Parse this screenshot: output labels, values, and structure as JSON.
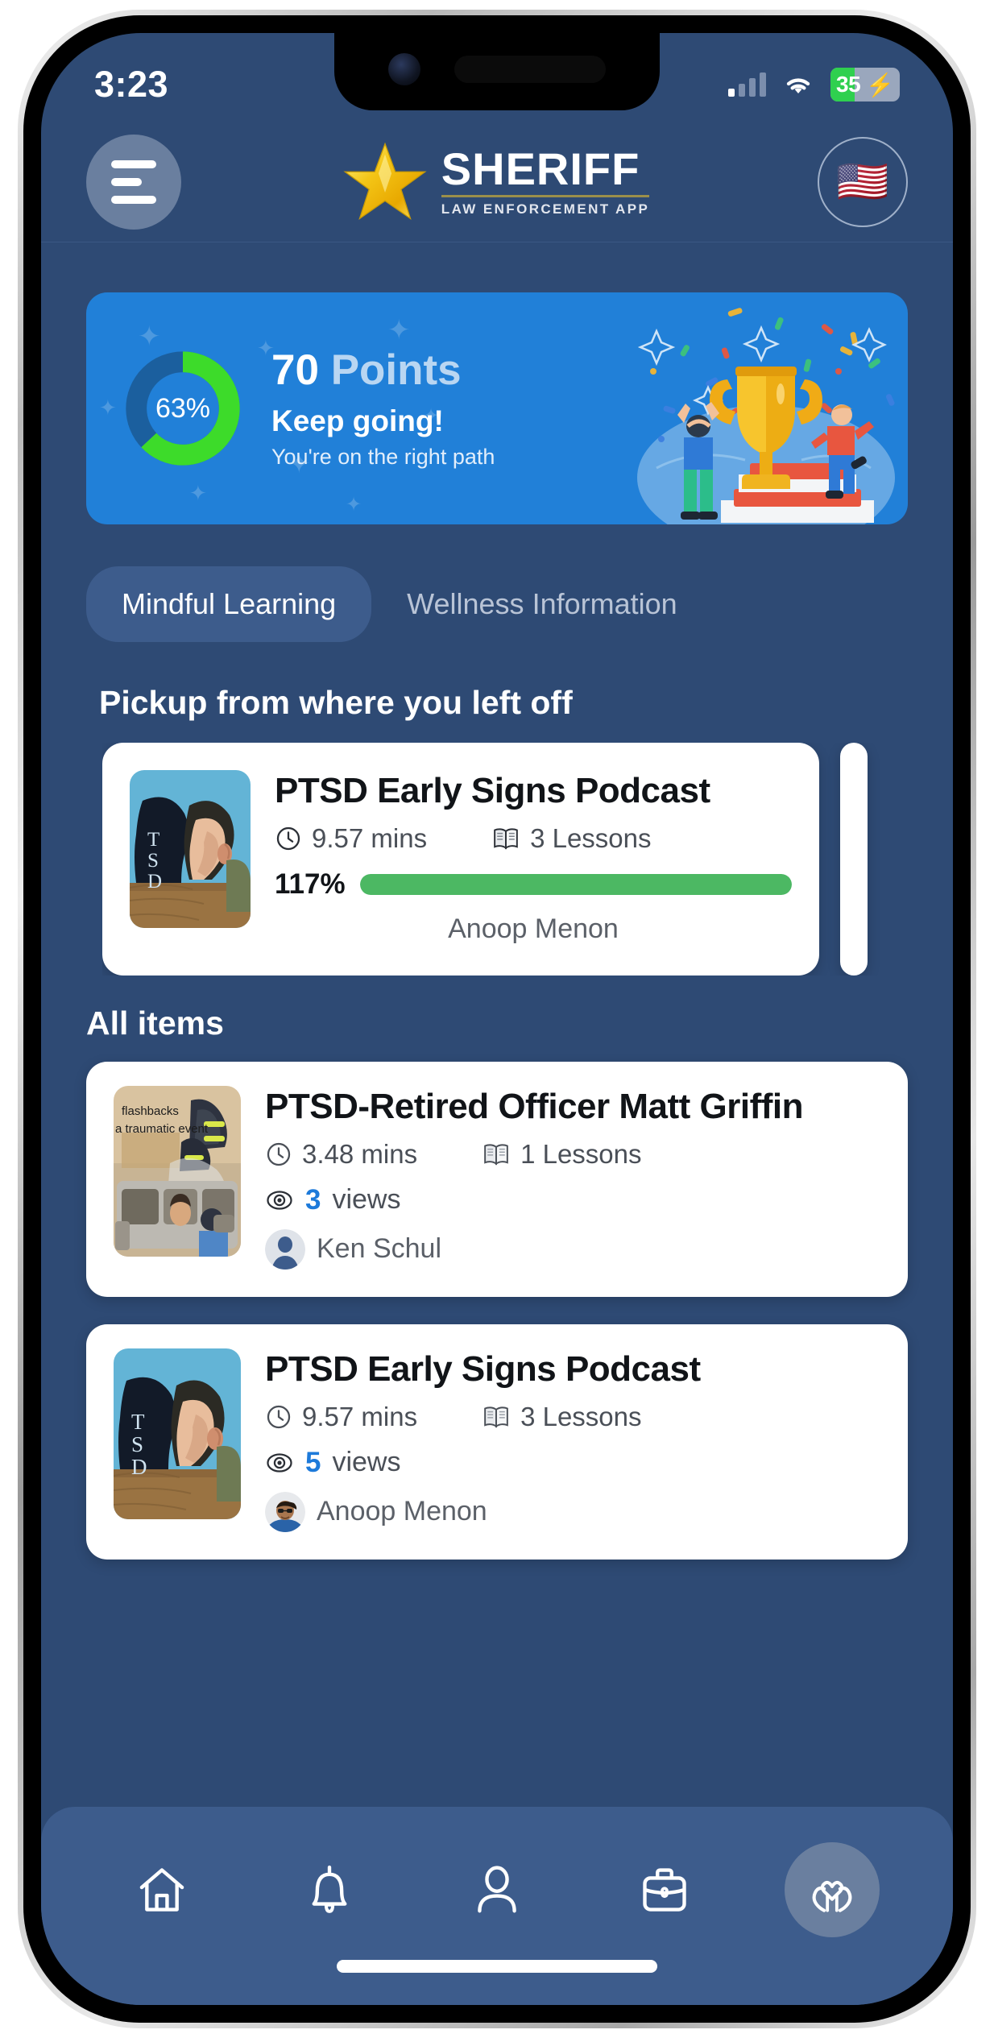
{
  "status_bar": {
    "time": "3:23",
    "signal_icon": "cellular-signal-icon",
    "wifi_icon": "wifi-icon",
    "battery_level": "35",
    "battery_charging": true,
    "battery_percent_value": 35
  },
  "header": {
    "menu_icon": "hamburger-menu-icon",
    "brand_title": "SHERIFF",
    "brand_subtitle": "LAW ENFORCEMENT APP",
    "brand_star_icon": "star-icon",
    "language_flag": "united-states-flag-icon",
    "flag_glyph": "🇺🇸"
  },
  "points_banner": {
    "progress_percent_label": "63%",
    "progress_percent_value": 63,
    "points_number": "70",
    "points_unit": "Points",
    "headline": "Keep going!",
    "subtext": "You're on the right path",
    "ring_color": "#3ddb2a",
    "ring_track_color": "#1b5f9e",
    "card_color": "#2180d8",
    "illustration": "trophy-celebration-illustration"
  },
  "tabs": [
    {
      "label": "Mindful Learning",
      "active": true
    },
    {
      "label": "Wellness Information",
      "active": false
    }
  ],
  "continue_section": {
    "heading": "Pickup from where you left off",
    "cards": [
      {
        "title": "PTSD Early Signs Podcast",
        "duration": "9.57 mins",
        "lessons": "3 Lessons",
        "progress_label": "117%",
        "progress_value": 100,
        "author": "Anoop Menon",
        "thumbnail": "ptsd-silhouette-thumbnail",
        "clock_icon": "clock-icon",
        "book_icon": "book-icon"
      }
    ]
  },
  "all_items_section": {
    "heading": "All items",
    "cards": [
      {
        "title": "PTSD-Retired Officer Matt Griffin",
        "duration": "3.48 mins",
        "lessons": "1 Lessons",
        "views_count": "3",
        "views_label": "views",
        "author": "Ken Schul",
        "thumbnail": "flashbacks-emergency-scene-thumbnail",
        "thumbnail_caption_line1": "flashbacks",
        "thumbnail_caption_line2": "a traumatic event",
        "avatar": "default-person-avatar",
        "clock_icon": "clock-icon",
        "book_icon": "book-icon",
        "eye_icon": "eye-icon"
      },
      {
        "title": "PTSD Early Signs Podcast",
        "duration": "9.57 mins",
        "lessons": "3 Lessons",
        "views_count": "5",
        "views_label": "views",
        "author": "Anoop Menon",
        "thumbnail": "ptsd-silhouette-thumbnail",
        "avatar": "anoop-menon-photo-avatar",
        "clock_icon": "clock-icon",
        "book_icon": "book-icon",
        "eye_icon": "eye-icon"
      }
    ]
  },
  "bottom_nav": [
    {
      "icon": "home-icon",
      "active": false
    },
    {
      "icon": "bell-icon",
      "active": false
    },
    {
      "icon": "person-icon",
      "active": false
    },
    {
      "icon": "briefcase-icon",
      "active": false
    },
    {
      "icon": "heart-in-hands-icon",
      "active": true
    }
  ],
  "colors": {
    "app_background": "#2e4a74",
    "nav_background": "#3d5c8c",
    "accent_blue": "#2180d8",
    "accent_green": "#4cb863",
    "link_blue": "#1d7ada"
  }
}
